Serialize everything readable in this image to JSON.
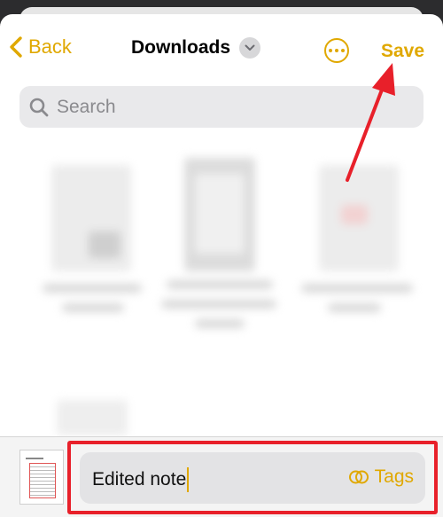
{
  "nav": {
    "back_label": "Back",
    "title": "Downloads",
    "save_label": "Save"
  },
  "search": {
    "placeholder": "Search"
  },
  "bottom": {
    "name_value": "Edited note",
    "tags_label": "Tags"
  },
  "colors": {
    "accent": "#e0a800",
    "annotation": "#e8202a"
  }
}
